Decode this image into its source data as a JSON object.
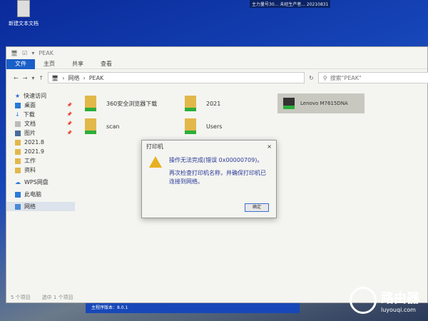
{
  "desktop": {
    "icon_label": "新建文本文档",
    "top_text": "主力量号30...   未经生产者...   20210831"
  },
  "window": {
    "title": "PEAK",
    "ribbon_tabs": [
      "文件",
      "主页",
      "共享",
      "查看"
    ],
    "address": [
      "网络",
      "PEAK"
    ],
    "search_placeholder": "搜索\"PEAK\"",
    "sidebar": [
      "快速访问",
      "桌面",
      "下载",
      "文档",
      "图片",
      "2021.8",
      "2021.9",
      "工作",
      "资料",
      "WPS网盘",
      "此电脑",
      "网络"
    ],
    "items": [
      "360安全浏览器下载",
      "2021",
      "scan",
      "Users"
    ],
    "printer": "Lenovo M7615DNA",
    "status": [
      "5 个项目",
      "选中 1 个项目"
    ]
  },
  "dialog": {
    "title": "打印机",
    "close": "×",
    "message": "操作无法完成(错误 0x00000709)。",
    "detail": "再次检查打印机名称，并确保打印机已连接到网络。",
    "ok": "确定"
  },
  "version_bar": "主程序版本：8.0.1",
  "watermark": {
    "name": "路由器",
    "url": "luyouqi.com"
  }
}
